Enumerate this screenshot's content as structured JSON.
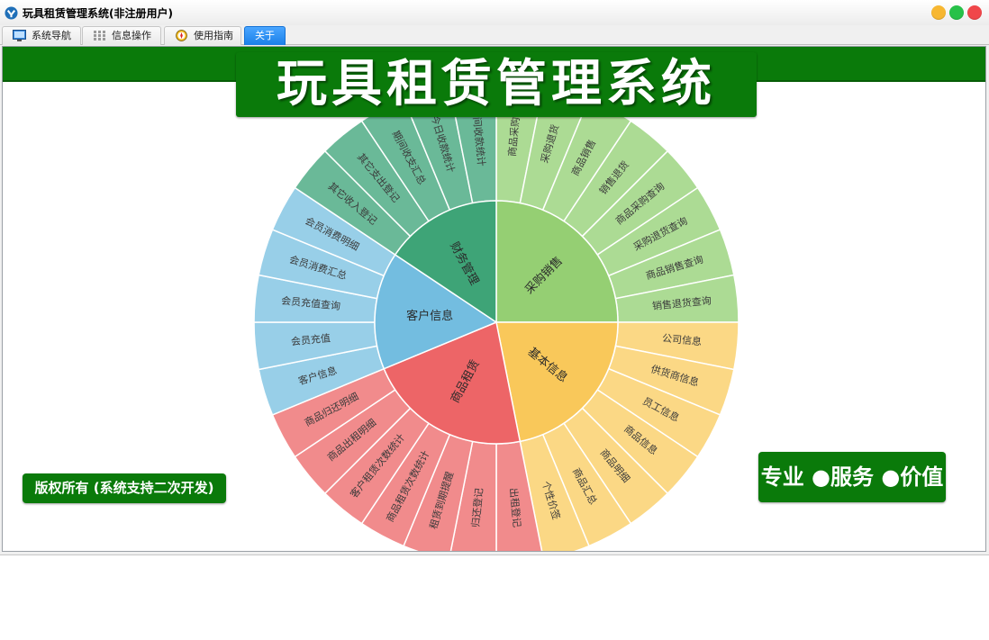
{
  "window": {
    "title": "玩具租赁管理系统(非注册用户)",
    "controls": [
      "minimize",
      "maximize",
      "close"
    ]
  },
  "tabs": [
    {
      "label": "系统导航",
      "icon": "monitor-icon",
      "active": false
    },
    {
      "label": "信息操作",
      "icon": "grid-icon",
      "active": false
    },
    {
      "label": "使用指南",
      "icon": "compass-icon",
      "active": false
    },
    {
      "label": "关于",
      "icon": "",
      "active": true
    }
  ],
  "main": {
    "title": "玩具租赁管理系统",
    "copyright": "版权所有 (系统支持二次开发)",
    "slogan": "专业 ●服务 ●价值"
  },
  "sunburst": {
    "groups": [
      {
        "name": "采购销售",
        "color": "#95cf73",
        "light": "#acdb94",
        "items": [
          "商品采购",
          "采购退货",
          "商品销售",
          "销售退货",
          "商品采购查询",
          "采购退货查询",
          "商品销售查询",
          "销售退货查询"
        ]
      },
      {
        "name": "基本信息",
        "color": "#f9c85a",
        "light": "#fbd885",
        "items": [
          "公司信息",
          "供货商信息",
          "员工信息",
          "商品信息",
          "商品明细",
          "商品汇总",
          "个性价签"
        ]
      },
      {
        "name": "商品租赁",
        "color": "#ed6567",
        "light": "#f18b8c",
        "items": [
          "出租登记",
          "归还登记",
          "租赁到期提醒",
          "商品租赁次数统计",
          "客户租赁次数统计",
          "商品出租明细",
          "商品归还明细"
        ]
      },
      {
        "name": "客户信息",
        "color": "#73bde0",
        "light": "#98cfe8",
        "items": [
          "客户信息",
          "会员充值",
          "会员充值查询",
          "会员消费汇总",
          "会员消费明细"
        ]
      },
      {
        "name": "财务管理",
        "color": "#3ea477",
        "light": "#6ab998",
        "items": [
          "其它收入登记",
          "其它支出登记",
          "期间收支汇总",
          "今日收款统计",
          "期间收款统计"
        ]
      }
    ]
  }
}
